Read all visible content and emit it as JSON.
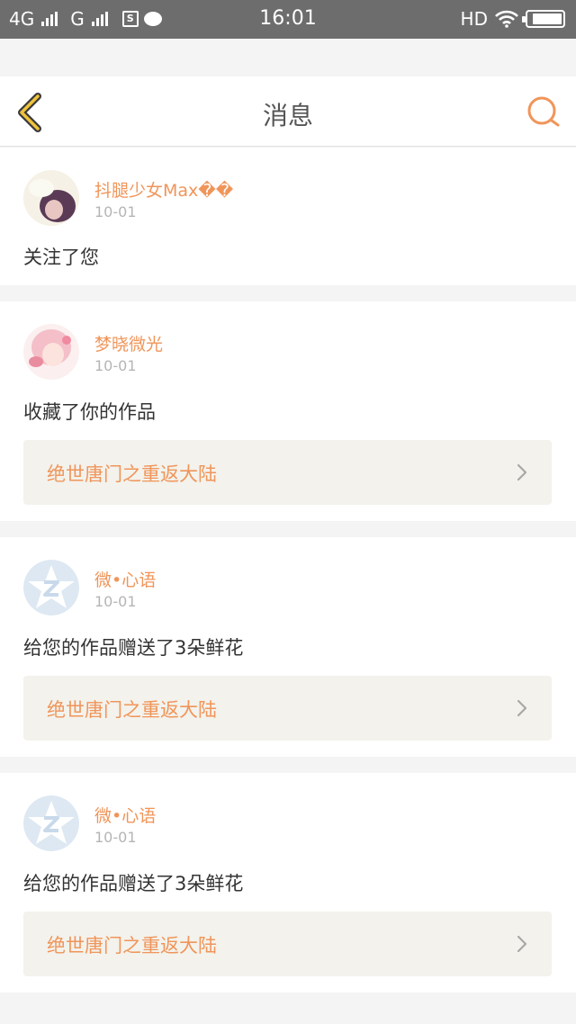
{
  "status_bar": {
    "network_1": "4G",
    "network_2": "G",
    "sim_icon": "S",
    "time": "16:01",
    "hd": "HD",
    "battery_level": 0.9
  },
  "nav": {
    "title": "消息",
    "back_icon": "chevron-left-icon",
    "search_icon": "search-icon",
    "accent_color": "#f0955a",
    "back_color": "#f0c33a"
  },
  "messages": [
    {
      "user": "抖腿少女Max��",
      "date": "10-01",
      "action": "关注了您"
    },
    {
      "user": "梦晓微光",
      "date": "10-01",
      "action": "收藏了你的作品",
      "work": "绝世唐门之重返大陆"
    },
    {
      "user": "微•心语",
      "date": "10-01",
      "action": "给您的作品赠送了3朵鲜花",
      "work": "绝世唐门之重返大陆"
    },
    {
      "user": "微•心语",
      "date": "10-01",
      "action": "给您的作品赠送了3朵鲜花",
      "work": "绝世唐门之重返大陆"
    }
  ]
}
